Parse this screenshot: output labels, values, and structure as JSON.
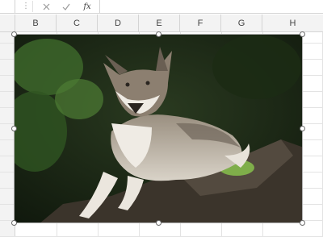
{
  "formula_bar": {
    "more_icon": "vertical-ellipsis",
    "cancel_icon": "x",
    "enter_icon": "check",
    "function_label": "fx",
    "value": ""
  },
  "columns": [
    "B",
    "C",
    "D",
    "E",
    "F",
    "G",
    "H"
  ],
  "picture": {
    "subject": "wolf lying on a rock",
    "selected": true
  },
  "colors": {
    "header_bg": "#f3f3f3",
    "gridline": "#e3e3e3",
    "handle": "#ffffff"
  }
}
